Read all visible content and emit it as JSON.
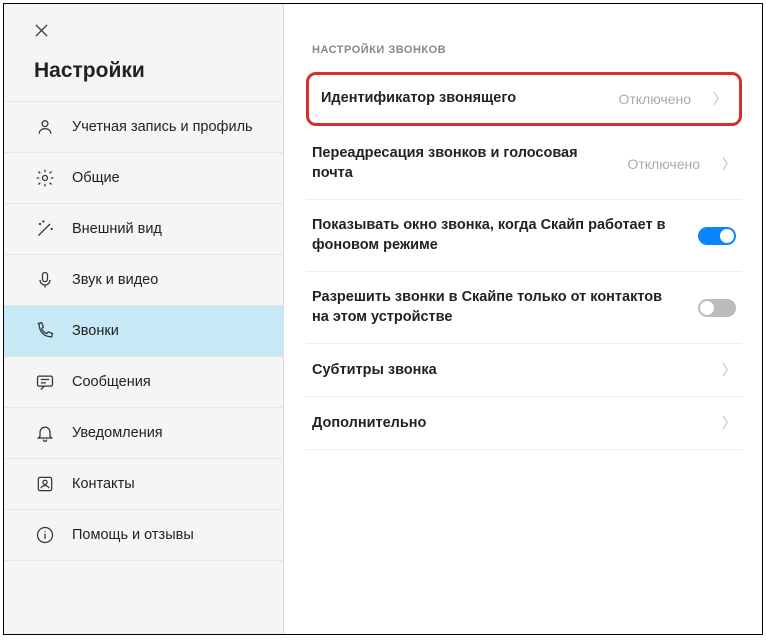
{
  "sidebar": {
    "title": "Настройки",
    "items": [
      {
        "label": "Учетная запись и профиль"
      },
      {
        "label": "Общие"
      },
      {
        "label": "Внешний вид"
      },
      {
        "label": "Звук и видео"
      },
      {
        "label": "Звонки"
      },
      {
        "label": "Сообщения"
      },
      {
        "label": "Уведомления"
      },
      {
        "label": "Контакты"
      },
      {
        "label": "Помощь и отзывы"
      }
    ]
  },
  "main": {
    "section_header": "НАСТРОЙКИ ЗВОНКОВ",
    "settings": {
      "caller_id": {
        "label": "Идентификатор звонящего",
        "value": "Отключено"
      },
      "forwarding": {
        "label": "Переадресация звонков и голосовая почта",
        "value": "Отключено"
      },
      "show_window": {
        "label": "Показывать окно звонка, когда Скайп работает в фоновом режиме",
        "on": true
      },
      "contacts_only": {
        "label": "Разрешить звонки в Скайпе только от контактов на этом устройстве",
        "on": false
      },
      "subtitles": {
        "label": "Субтитры звонка"
      },
      "advanced": {
        "label": "Дополнительно"
      }
    }
  }
}
